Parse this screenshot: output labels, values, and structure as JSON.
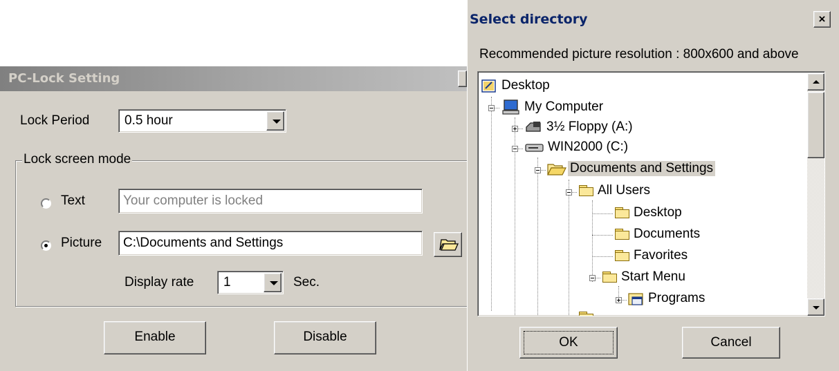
{
  "lock_dialog": {
    "title": "PC-Lock Setting",
    "lock_period_label": "Lock Period",
    "lock_period_value": "0.5 hour",
    "mode_group_label": "Lock screen mode",
    "text_option_label": "Text",
    "text_value": "Your computer is locked",
    "picture_option_label": "Picture",
    "picture_path": "C:\\Documents and Settings",
    "selected_mode": "Picture",
    "display_rate_label": "Display rate",
    "display_rate_value": "1",
    "display_rate_unit": "Sec.",
    "enable_label": "Enable",
    "disable_label": "Disable",
    "browse_icon": "folder-open-icon"
  },
  "dir_dialog": {
    "title": "Select directory",
    "close_glyph": "×",
    "hint": "Recommended picture resolution : 800x600 and above",
    "tree": [
      {
        "label": "Desktop",
        "icon": "desktop-icon",
        "level": 0
      },
      {
        "label": "My Computer",
        "icon": "computer-icon",
        "level": 1,
        "expanded": true
      },
      {
        "label": "3½ Floppy (A:)",
        "icon": "floppy-drive-icon",
        "level": 2,
        "expanded": false
      },
      {
        "label": "WIN2000 (C:)",
        "icon": "hard-drive-icon",
        "level": 2,
        "expanded": true
      },
      {
        "label": "Documents and Settings",
        "icon": "folder-open-icon",
        "level": 3,
        "expanded": true,
        "selected": true
      },
      {
        "label": "All Users",
        "icon": "folder-icon",
        "level": 4,
        "expanded": true
      },
      {
        "label": "Desktop",
        "icon": "folder-icon",
        "level": 5
      },
      {
        "label": "Documents",
        "icon": "folder-icon",
        "level": 5
      },
      {
        "label": "Favorites",
        "icon": "folder-icon",
        "level": 5
      },
      {
        "label": "Start Menu",
        "icon": "folder-icon",
        "level": 5,
        "expanded": true
      },
      {
        "label": "Programs",
        "icon": "programs-folder-icon",
        "level": 6,
        "expanded": false
      }
    ],
    "ok_label": "OK",
    "cancel_label": "Cancel"
  },
  "colors": {
    "dialog_face": "#d4d0c8",
    "inactive_title_start": "#808080",
    "inactive_title_end": "#c0c0c0",
    "selection_highlight": "#d4d0c8",
    "disabled_text": "#808080"
  }
}
